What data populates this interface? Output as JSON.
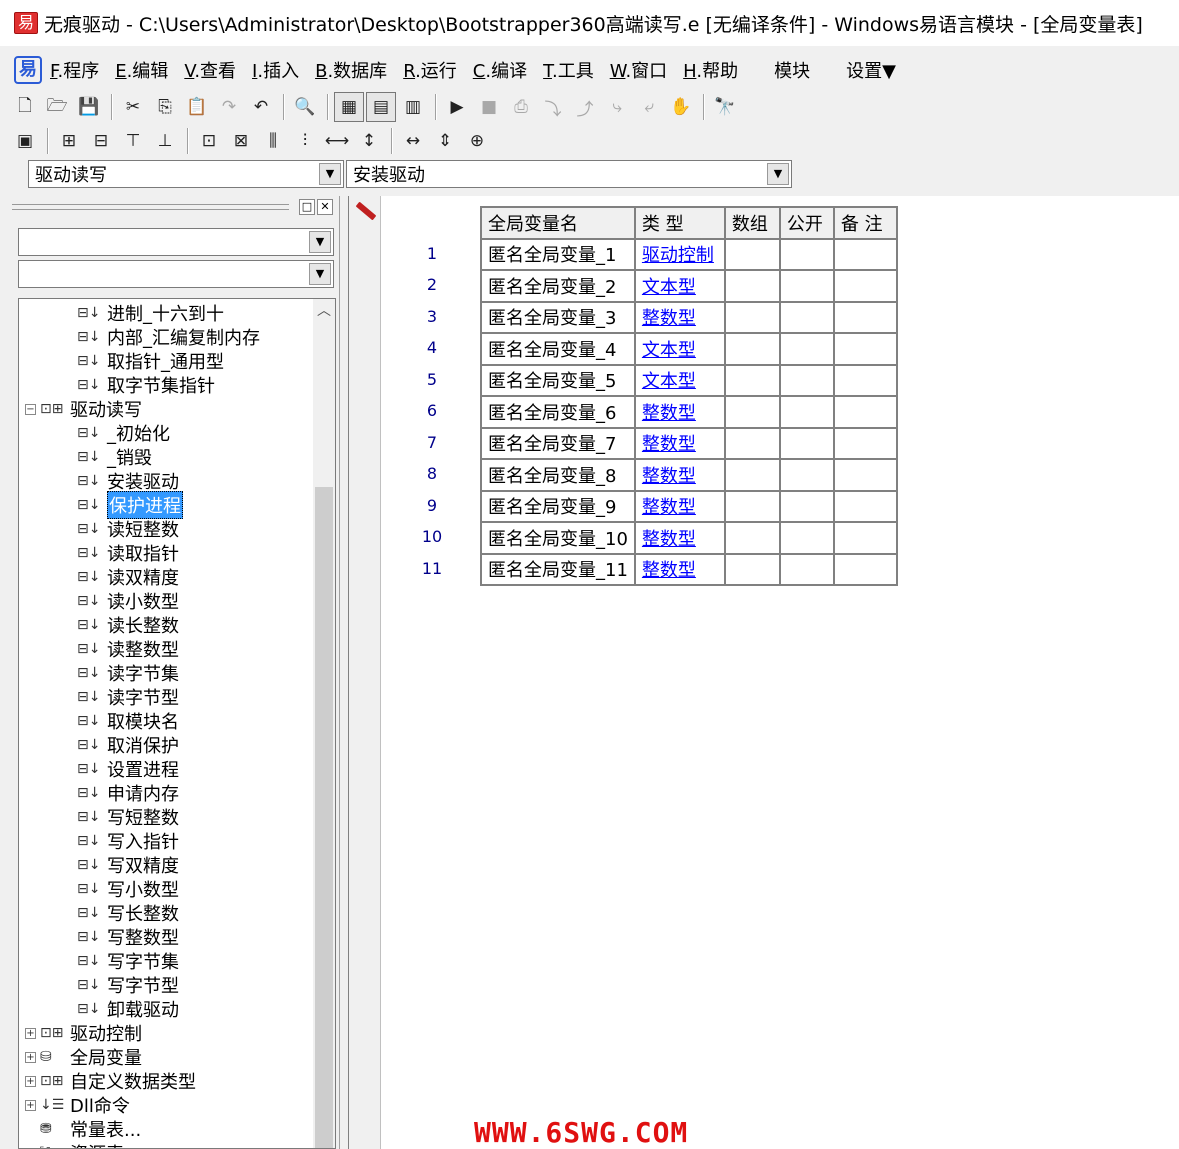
{
  "window": {
    "title": "无痕驱动 - C:\\Users\\Administrator\\Desktop\\Bootstrapper360高端读写.e [无编译条件] - Windows易语言模块 - [全局变量表]"
  },
  "menu": {
    "items": [
      {
        "key": "F",
        "label": ".程序"
      },
      {
        "key": "E",
        "label": ".编辑"
      },
      {
        "key": "V",
        "label": ".查看"
      },
      {
        "key": "I",
        "label": ".插入"
      },
      {
        "key": "B",
        "label": ".数据库"
      },
      {
        "key": "R",
        "label": ".运行"
      },
      {
        "key": "C",
        "label": ".编译"
      },
      {
        "key": "T",
        "label": ".工具"
      },
      {
        "key": "W",
        "label": ".窗口"
      },
      {
        "key": "H",
        "label": ".帮助"
      }
    ],
    "module": "模块",
    "settings": "设置▼"
  },
  "toolbar1": [
    {
      "icon": "new-file-icon",
      "glyph": "🗋"
    },
    {
      "icon": "open-folder-icon",
      "glyph": "🗁"
    },
    {
      "icon": "save-icon",
      "glyph": "💾"
    },
    {
      "sep": true
    },
    {
      "icon": "cut-icon",
      "glyph": "✂"
    },
    {
      "icon": "copy-icon",
      "glyph": "⎘"
    },
    {
      "icon": "paste-icon",
      "glyph": "📋"
    },
    {
      "icon": "redo-icon",
      "glyph": "↷",
      "disabled": true
    },
    {
      "icon": "undo-icon",
      "glyph": "↶"
    },
    {
      "sep": true
    },
    {
      "icon": "find-icon",
      "glyph": "🔍"
    },
    {
      "sep": true
    },
    {
      "icon": "layout-1-icon",
      "glyph": "▦",
      "pressed": true
    },
    {
      "icon": "layout-2-icon",
      "glyph": "▤",
      "pressed": true
    },
    {
      "icon": "layout-3-icon",
      "glyph": "▥"
    },
    {
      "sep": true
    },
    {
      "icon": "run-icon",
      "glyph": "▶"
    },
    {
      "icon": "stop-icon",
      "glyph": "■",
      "disabled": true
    },
    {
      "icon": "debug-1-icon",
      "glyph": "⎙",
      "disabled": true
    },
    {
      "icon": "debug-2-icon",
      "glyph": "⤵",
      "disabled": true
    },
    {
      "icon": "debug-3-icon",
      "glyph": "⤴",
      "disabled": true
    },
    {
      "icon": "debug-4-icon",
      "glyph": "⤷",
      "disabled": true
    },
    {
      "icon": "debug-5-icon",
      "glyph": "⤶",
      "disabled": true
    },
    {
      "icon": "hand-icon",
      "glyph": "✋",
      "disabled": true
    },
    {
      "sep": true
    },
    {
      "icon": "binoculars-icon",
      "glyph": "🔭"
    }
  ],
  "toolbar2": [
    {
      "icon": "align-grid-icon",
      "glyph": "▣"
    },
    {
      "sep": true
    },
    {
      "icon": "align-left-icon",
      "glyph": "⊞"
    },
    {
      "icon": "align-right-icon",
      "glyph": "⊟"
    },
    {
      "icon": "align-top-icon",
      "glyph": "⊤"
    },
    {
      "icon": "align-bottom-icon",
      "glyph": "⊥"
    },
    {
      "sep": true
    },
    {
      "icon": "center-h-icon",
      "glyph": "⊡"
    },
    {
      "icon": "center-v-icon",
      "glyph": "⊠"
    },
    {
      "icon": "space-h-icon",
      "glyph": "⫼"
    },
    {
      "icon": "space-v-icon",
      "glyph": "⫶"
    },
    {
      "icon": "distribute-h-icon",
      "glyph": "⟷"
    },
    {
      "icon": "distribute-v-icon",
      "glyph": "↕"
    },
    {
      "sep": true
    },
    {
      "icon": "same-width-icon",
      "glyph": "↔"
    },
    {
      "icon": "same-height-icon",
      "glyph": "⇕"
    },
    {
      "icon": "same-size-icon",
      "glyph": "⊕"
    }
  ],
  "selectors": {
    "left": "驱动读写",
    "right": "安装驱动"
  },
  "tree": {
    "items": [
      {
        "label": "进制_十六到十",
        "kind": "sub"
      },
      {
        "label": "内部_汇编复制内存",
        "kind": "sub"
      },
      {
        "label": "取指针_通用型",
        "kind": "sub"
      },
      {
        "label": "取字节集指针",
        "kind": "sub"
      },
      {
        "label": "驱动读写",
        "kind": "class",
        "expander": "−"
      },
      {
        "label": "_初始化",
        "kind": "sub"
      },
      {
        "label": "_销毁",
        "kind": "sub"
      },
      {
        "label": "安装驱动",
        "kind": "sub"
      },
      {
        "label": "保护进程",
        "kind": "sub",
        "selected": true
      },
      {
        "label": "读短整数",
        "kind": "sub"
      },
      {
        "label": "读取指针",
        "kind": "sub"
      },
      {
        "label": "读双精度",
        "kind": "sub"
      },
      {
        "label": "读小数型",
        "kind": "sub"
      },
      {
        "label": "读长整数",
        "kind": "sub"
      },
      {
        "label": "读整数型",
        "kind": "sub"
      },
      {
        "label": "读字节集",
        "kind": "sub"
      },
      {
        "label": "读字节型",
        "kind": "sub"
      },
      {
        "label": "取模块名",
        "kind": "sub"
      },
      {
        "label": "取消保护",
        "kind": "sub"
      },
      {
        "label": "设置进程",
        "kind": "sub"
      },
      {
        "label": "申请内存",
        "kind": "sub"
      },
      {
        "label": "写短整数",
        "kind": "sub"
      },
      {
        "label": "写入指针",
        "kind": "sub"
      },
      {
        "label": "写双精度",
        "kind": "sub"
      },
      {
        "label": "写小数型",
        "kind": "sub"
      },
      {
        "label": "写长整数",
        "kind": "sub"
      },
      {
        "label": "写整数型",
        "kind": "sub"
      },
      {
        "label": "写字节集",
        "kind": "sub"
      },
      {
        "label": "写字节型",
        "kind": "sub"
      },
      {
        "label": "卸载驱动",
        "kind": "sub"
      },
      {
        "label": "驱动控制",
        "kind": "class",
        "expander": "+"
      },
      {
        "label": "全局变量",
        "kind": "global",
        "expander": "+"
      },
      {
        "label": "自定义数据类型",
        "kind": "class",
        "expander": "+"
      },
      {
        "label": "Dll命令",
        "kind": "dll",
        "expander": "+"
      },
      {
        "label": "常量表...",
        "kind": "const"
      },
      {
        "label": "资源表",
        "kind": "res",
        "expander": "+"
      }
    ]
  },
  "globals": {
    "headers": [
      "全局变量名",
      "类 型",
      "数组",
      "公开",
      "备 注"
    ],
    "rows": [
      {
        "num": "1",
        "name": "匿名全局变量_1",
        "type": "驱动控制"
      },
      {
        "num": "2",
        "name": "匿名全局变量_2",
        "type": "文本型"
      },
      {
        "num": "3",
        "name": "匿名全局变量_3",
        "type": "整数型"
      },
      {
        "num": "4",
        "name": "匿名全局变量_4",
        "type": "文本型"
      },
      {
        "num": "5",
        "name": "匿名全局变量_5",
        "type": "文本型"
      },
      {
        "num": "6",
        "name": "匿名全局变量_6",
        "type": "整数型"
      },
      {
        "num": "7",
        "name": "匿名全局变量_7",
        "type": "整数型"
      },
      {
        "num": "8",
        "name": "匿名全局变量_8",
        "type": "整数型"
      },
      {
        "num": "9",
        "name": "匿名全局变量_9",
        "type": "整数型"
      },
      {
        "num": "10",
        "name": "匿名全局变量_10",
        "type": "整数型"
      },
      {
        "num": "11",
        "name": "匿名全局变量_11",
        "type": "整数型"
      }
    ]
  },
  "watermark": "WWW.6SWG.COM"
}
